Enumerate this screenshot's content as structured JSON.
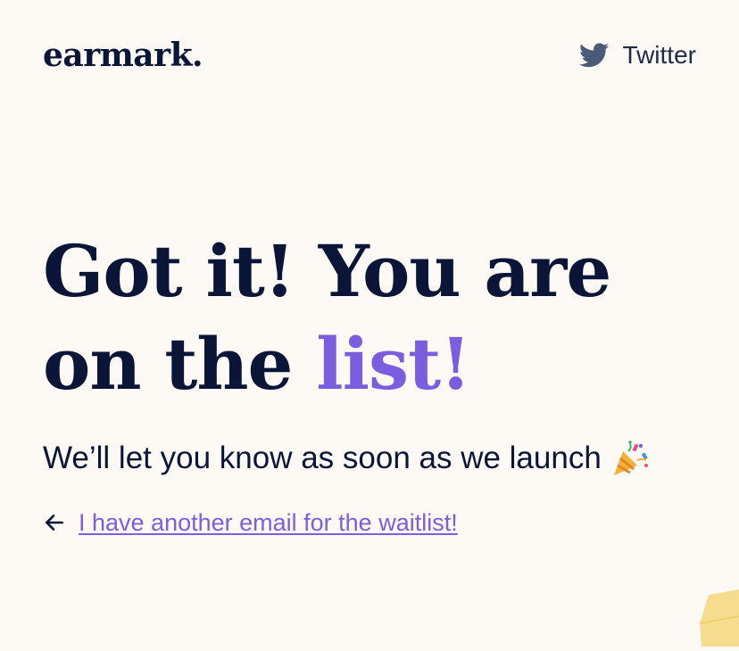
{
  "header": {
    "logo_text": "earmark.",
    "twitter_label": "Twitter"
  },
  "hero": {
    "headline_part1": "Got it! You are on the ",
    "headline_accent": "list!",
    "subtext": "We’ll let you know as soon as we launch",
    "subtext_icon": "party-popper-icon"
  },
  "back_link": {
    "icon": "arrow-left-icon",
    "label": "I have another email for the waitlist!"
  },
  "colors": {
    "background": "#fdf9f5",
    "text": "#0b1537",
    "accent": "#7b5ee0",
    "twitter_icon": "#4b5a78"
  }
}
